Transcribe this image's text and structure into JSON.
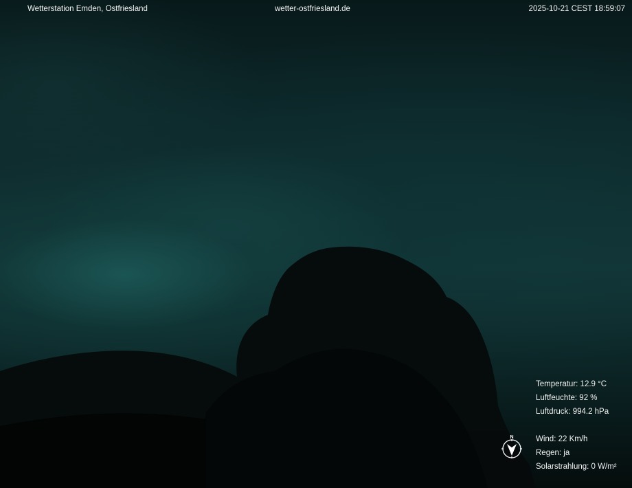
{
  "overlay": {
    "station_name": "Wetterstation Emden, Ostfriesland",
    "website": "wetter-ostfriesland.de",
    "timestamp": "2025-10-21 CEST 18:59:07"
  },
  "readings": {
    "temperature": "Temperatur: 12.9 °C",
    "humidity": "Luftfeuchte: 92 %",
    "pressure": "Luftdruck: 994.2 hPa",
    "wind": "Wind: 22 Km/h",
    "rain": "Regen: ja",
    "solar": "Solarstrahlung: 0 W/m²"
  },
  "compass": {
    "north_label": "N",
    "icon": "wind-direction-compass-icon"
  },
  "colors": {
    "overlay_text": "#f2f2f2",
    "sky": "#123536",
    "tree_silhouette": "#060909"
  }
}
